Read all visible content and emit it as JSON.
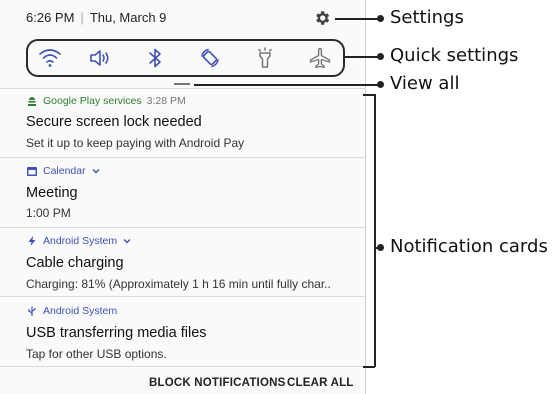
{
  "status": {
    "time": "6:26 PM",
    "separator": "|",
    "date": "Thu, March 9"
  },
  "quick_settings_icons": [
    "wifi-icon",
    "volume-icon",
    "bluetooth-icon",
    "auto-rotate-icon",
    "flashlight-icon",
    "airplane-mode-icon"
  ],
  "notifications": [
    {
      "app": "Google Play services",
      "time": "3:28 PM",
      "title": "Secure screen lock needed",
      "text": "Set it up to keep paying with Android Pay",
      "icon": "android-pay-icon",
      "app_color": "#2e7d32"
    },
    {
      "app": "Calendar",
      "title": "Meeting",
      "text": "1:00 PM",
      "icon": "calendar-icon",
      "app_color": "#3f51b5"
    },
    {
      "app": "Android System",
      "title": "Cable charging",
      "text": "Charging: 81% (Approximately 1 h 16 min until fully char..",
      "icon": "bolt-icon",
      "app_color": "#3f51b5"
    },
    {
      "app": "Android System",
      "title": "USB transferring media files",
      "text": "Tap for other USB options.",
      "icon": "usb-icon",
      "app_color": "#3f51b5"
    }
  ],
  "actions": {
    "block": "BLOCK NOTIFICATIONS",
    "clear": "CLEAR ALL"
  },
  "callouts": {
    "settings": "Settings",
    "quick_settings": "Quick settings",
    "view_all": "View all",
    "notification_cards": "Notification cards"
  },
  "colors": {
    "accent": "#3f51b5",
    "panel_border": "#2b2b2b"
  }
}
